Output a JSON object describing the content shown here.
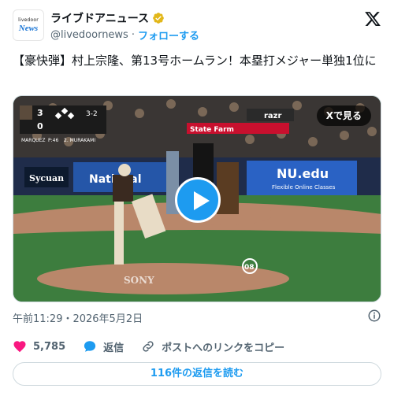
{
  "account": {
    "name": "ライブドアニュース",
    "handle": "@livedoornews",
    "follow_label": "フォローする",
    "avatar_top": "livedoor",
    "avatar_main": "News"
  },
  "post": {
    "text": "【豪快弾】村上宗隆、第13号ホームラン！本塁打メジャー単独1位に",
    "timestamp": "午前11:29・2026年5月2日"
  },
  "media": {
    "view_on_x_label": "Xで見る",
    "scoreboard": {
      "team_score": "3",
      "opp_score": "0",
      "count": "3-2",
      "outs": "2",
      "pitcher": "MARQUEZ",
      "pitch_count": "P:46",
      "batter": "2. MURAKAMI"
    },
    "signs": [
      "State Farm",
      "razr",
      "NU.edu",
      "Flexible Online Classes",
      "Sycuan",
      "National",
      "SONY"
    ],
    "jersey_number": "08"
  },
  "actions": {
    "likes": "5,785",
    "reply_label": "返信",
    "share_label": "ポストへのリンクをコピー"
  },
  "replies_button": "116件の返信を読む",
  "colors": {
    "accent": "#1d9bf0",
    "like": "#f91880",
    "text": "#0f1419",
    "muted": "#536471"
  }
}
